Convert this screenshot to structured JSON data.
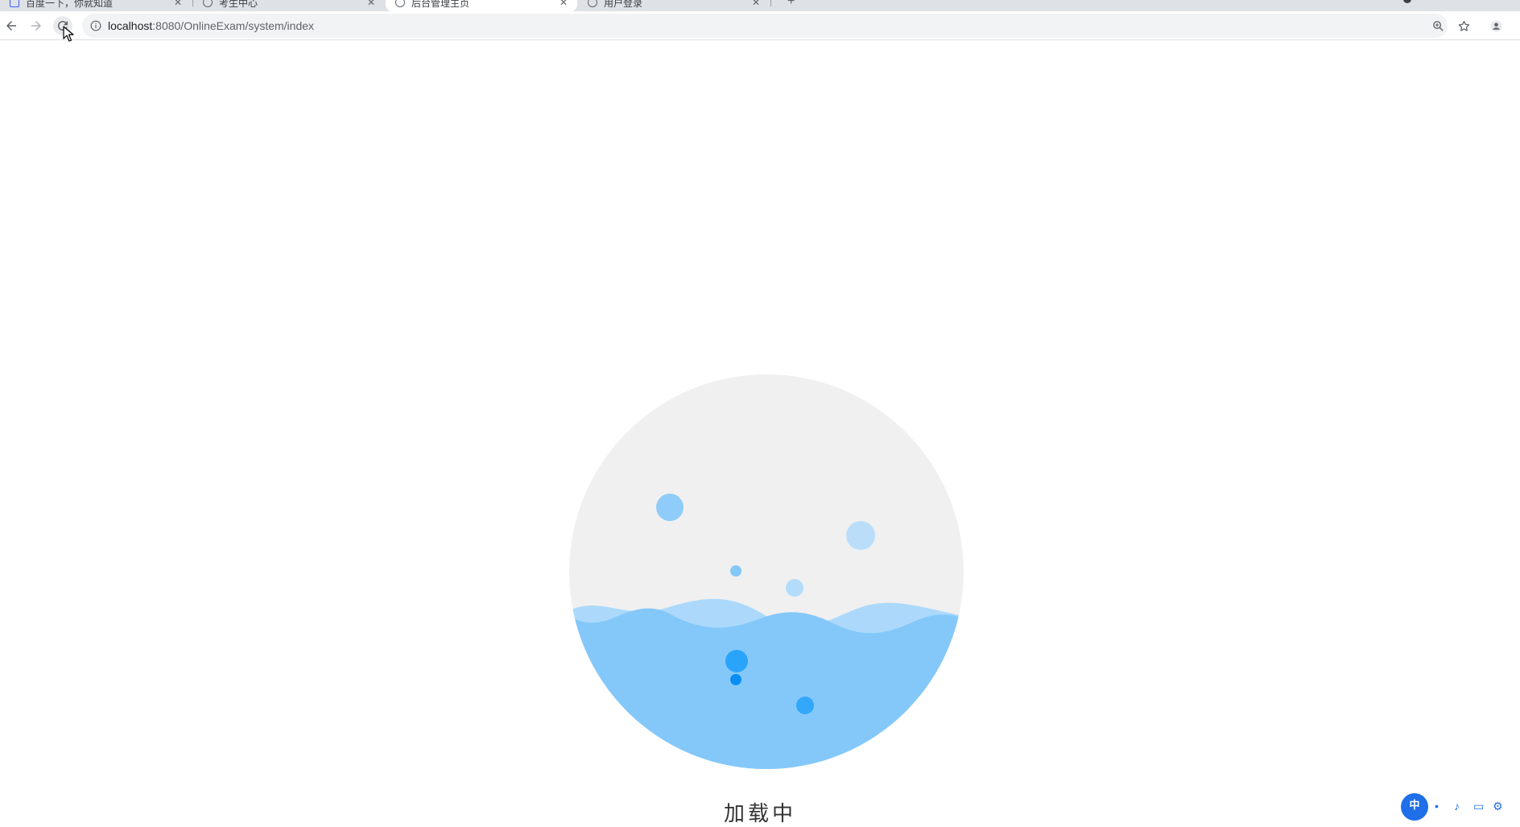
{
  "browser": {
    "tabs": [
      {
        "title": "百度一下，你就知道",
        "favicon": "baidu-icon",
        "active": false
      },
      {
        "title": "考生中心",
        "favicon": "globe-icon",
        "active": false
      },
      {
        "title": "后台管理主页",
        "favicon": "globe-icon",
        "active": true
      },
      {
        "title": "用户登录",
        "favicon": "globe-icon",
        "active": false
      }
    ],
    "new_tab_label": "+",
    "address": {
      "host": "localhost",
      "path": ":8080/OnlineExam/system/index"
    }
  },
  "page": {
    "loading_text": "加载中",
    "widget_logo": "中"
  },
  "colors": {
    "loader_bg": "#f0f0f0",
    "water_front": "#84c8fa",
    "water_back": "#acd9fb",
    "bubble_dark": "#1a9cfa"
  }
}
